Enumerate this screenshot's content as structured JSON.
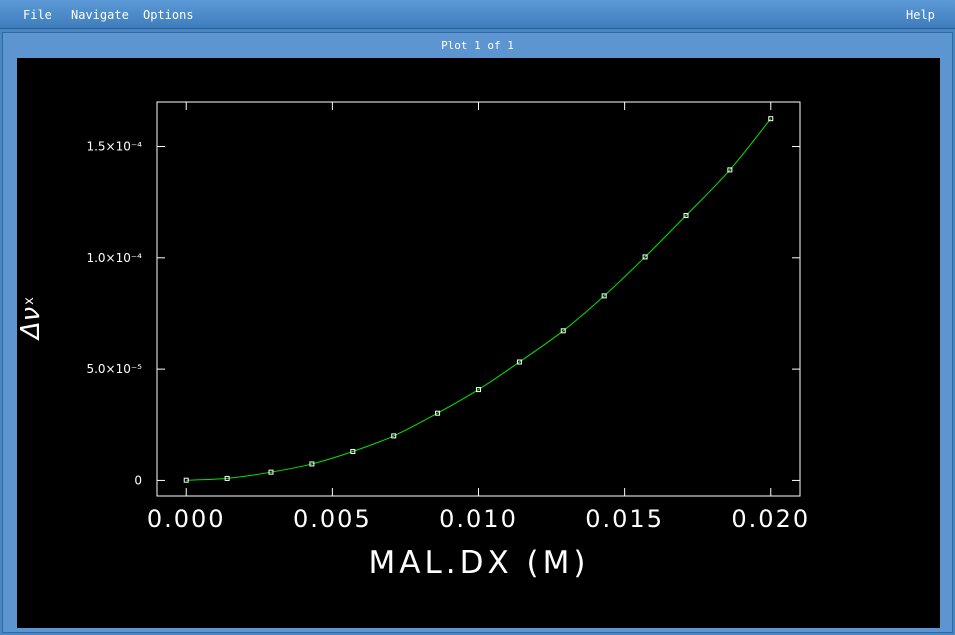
{
  "menu": {
    "file": "File",
    "navigate": "Navigate",
    "options": "Options",
    "help": "Help"
  },
  "window": {
    "title": "Plot 1 of 1"
  },
  "colors": {
    "background": "#000000",
    "axes": "#ffffff",
    "curve": "#00e600",
    "markers": "#ffffff"
  },
  "chart_data": {
    "type": "line",
    "title": "",
    "xlabel": "MAL.DX  (M)",
    "ylabel": "Δν",
    "ylabel_subscript": "x",
    "xlim": [
      -0.001,
      0.021
    ],
    "ylim": [
      -7e-06,
      0.00017
    ],
    "xticks": [
      0.0,
      0.005,
      0.01,
      0.015,
      0.02
    ],
    "xtick_labels": [
      "0.000",
      "0.005",
      "0.010",
      "0.015",
      "0.020"
    ],
    "yticks": [
      0,
      5e-05,
      0.0001,
      0.00015
    ],
    "ytick_labels": [
      "0",
      "5.0×10⁻⁵",
      "1.0×10⁻⁴",
      "1.5×10⁻⁴"
    ],
    "grid": false,
    "series": [
      {
        "x": [
          0.0,
          0.0014,
          0.0029,
          0.0043,
          0.0057,
          0.0071,
          0.0086,
          0.01,
          0.0114,
          0.0129,
          0.0143,
          0.0157,
          0.0171,
          0.0186,
          0.02
        ],
        "y": [
          1e-07,
          9e-07,
          3.7e-06,
          7.4e-06,
          1.3e-05,
          2e-05,
          3.02e-05,
          4.08e-05,
          5.32e-05,
          6.72e-05,
          8.29e-05,
          0.0001004,
          0.000119,
          0.0001395,
          0.0001625
        ]
      }
    ]
  }
}
